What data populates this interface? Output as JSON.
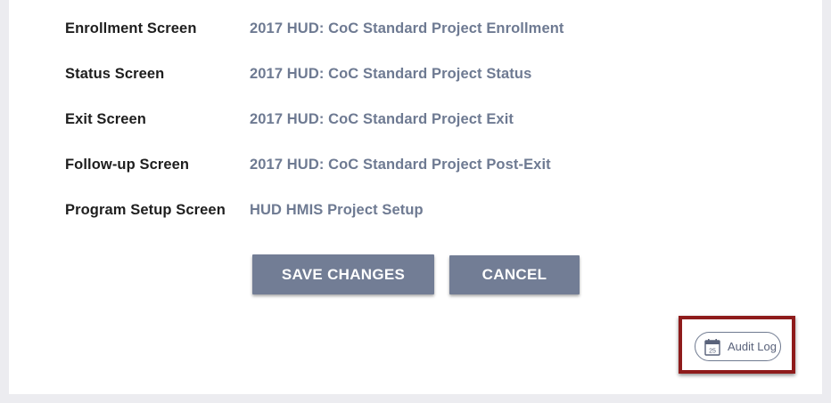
{
  "settings": {
    "rows": [
      {
        "label": "Enrollment Screen",
        "value": "2017 HUD: CoC Standard Project Enrollment"
      },
      {
        "label": "Status Screen",
        "value": "2017 HUD: CoC Standard Project Status"
      },
      {
        "label": "Exit Screen",
        "value": "2017 HUD: CoC Standard Project Exit"
      },
      {
        "label": "Follow-up Screen",
        "value": "2017 HUD: CoC Standard Project Post-Exit"
      },
      {
        "label": "Program Setup Screen",
        "value": "HUD HMIS Project Setup"
      }
    ]
  },
  "actions": {
    "save_label": "SAVE CHANGES",
    "cancel_label": "CANCEL"
  },
  "audit": {
    "label": "Audit Log",
    "icon": "calendar-icon",
    "icon_day": "25"
  },
  "colors": {
    "button_bg": "#727d95",
    "link_text": "#6e7a92",
    "highlight_border": "#8e1b1b"
  }
}
